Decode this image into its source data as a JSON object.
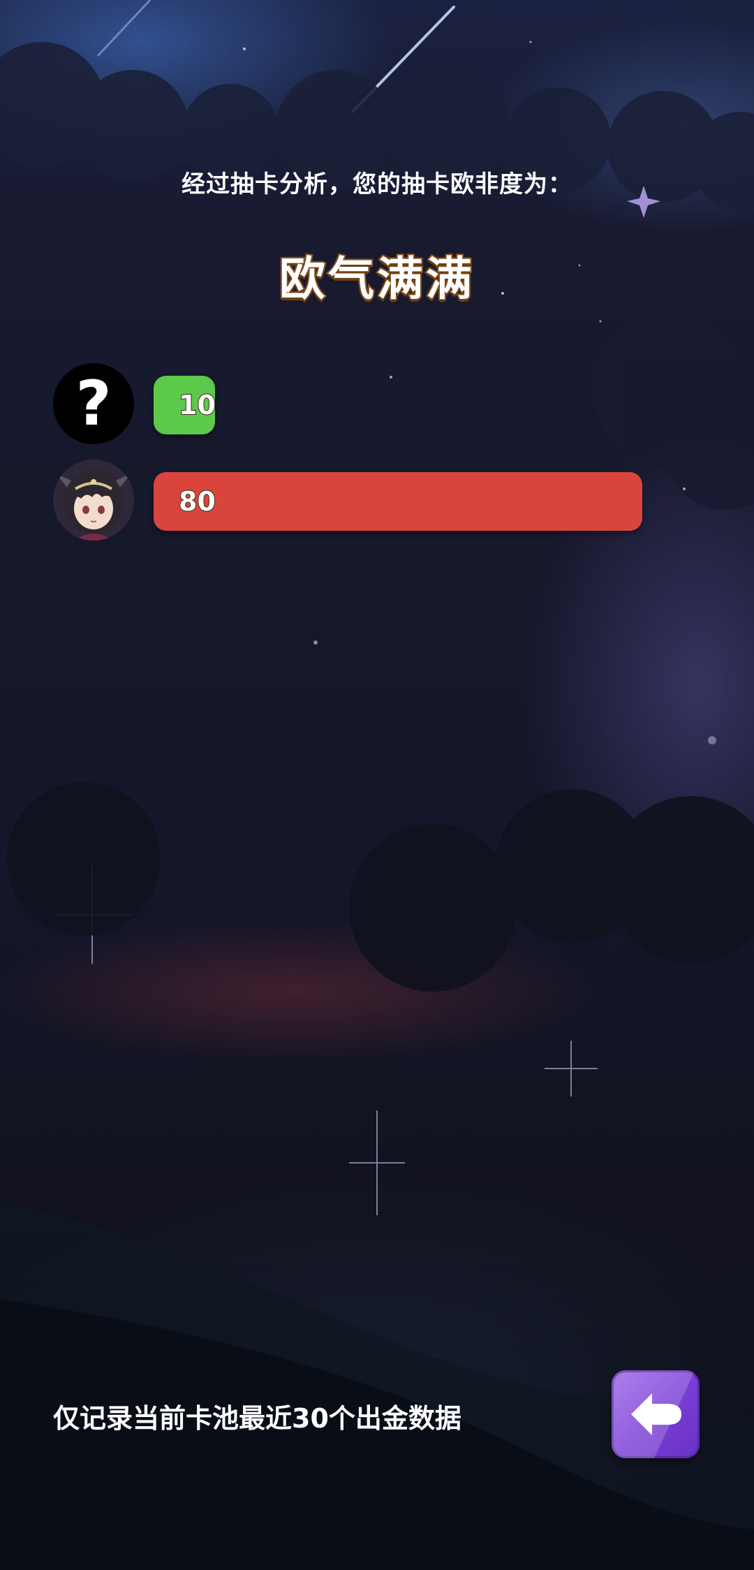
{
  "screen": {
    "intro_text": "经过抽卡分析，您的抽卡欧非度为：",
    "verdict": "欧气满满"
  },
  "records": [
    {
      "avatar": "question-mark-icon",
      "avatar_text": "?",
      "value": 10,
      "value_text": "10",
      "bar_color": "#5cc94a",
      "fill": 0.125
    },
    {
      "avatar": "anime-girl-avatar",
      "value": 80,
      "value_text": "80",
      "bar_color": "#d9453d",
      "fill": 1.0
    }
  ],
  "footer": {
    "note": "仅记录当前卡池最近30个出金数据",
    "back_button_icon": "back-arrow-icon",
    "back_button_color": "#7a3fd6"
  }
}
